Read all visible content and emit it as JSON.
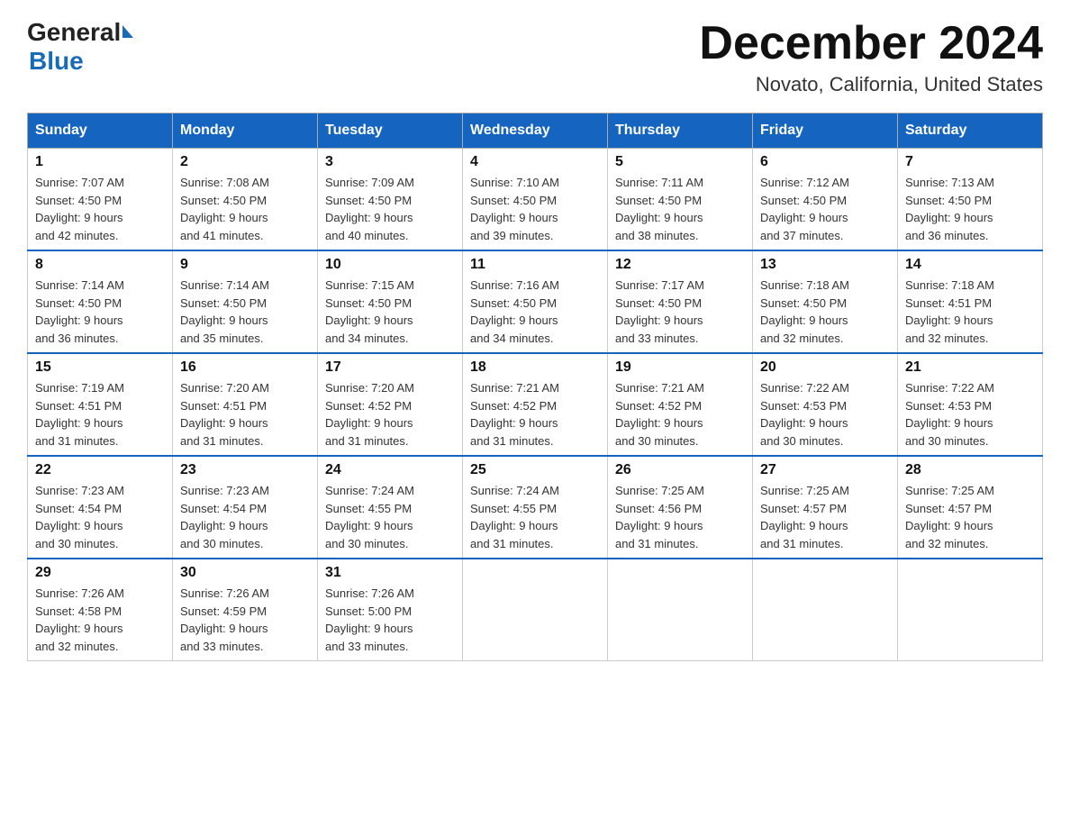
{
  "header": {
    "logo_general": "General",
    "logo_blue": "Blue",
    "month_title": "December 2024",
    "location": "Novato, California, United States"
  },
  "days_of_week": [
    "Sunday",
    "Monday",
    "Tuesday",
    "Wednesday",
    "Thursday",
    "Friday",
    "Saturday"
  ],
  "weeks": [
    [
      {
        "day": "1",
        "sunrise": "7:07 AM",
        "sunset": "4:50 PM",
        "daylight": "9 hours and 42 minutes."
      },
      {
        "day": "2",
        "sunrise": "7:08 AM",
        "sunset": "4:50 PM",
        "daylight": "9 hours and 41 minutes."
      },
      {
        "day": "3",
        "sunrise": "7:09 AM",
        "sunset": "4:50 PM",
        "daylight": "9 hours and 40 minutes."
      },
      {
        "day": "4",
        "sunrise": "7:10 AM",
        "sunset": "4:50 PM",
        "daylight": "9 hours and 39 minutes."
      },
      {
        "day": "5",
        "sunrise": "7:11 AM",
        "sunset": "4:50 PM",
        "daylight": "9 hours and 38 minutes."
      },
      {
        "day": "6",
        "sunrise": "7:12 AM",
        "sunset": "4:50 PM",
        "daylight": "9 hours and 37 minutes."
      },
      {
        "day": "7",
        "sunrise": "7:13 AM",
        "sunset": "4:50 PM",
        "daylight": "9 hours and 36 minutes."
      }
    ],
    [
      {
        "day": "8",
        "sunrise": "7:14 AM",
        "sunset": "4:50 PM",
        "daylight": "9 hours and 36 minutes."
      },
      {
        "day": "9",
        "sunrise": "7:14 AM",
        "sunset": "4:50 PM",
        "daylight": "9 hours and 35 minutes."
      },
      {
        "day": "10",
        "sunrise": "7:15 AM",
        "sunset": "4:50 PM",
        "daylight": "9 hours and 34 minutes."
      },
      {
        "day": "11",
        "sunrise": "7:16 AM",
        "sunset": "4:50 PM",
        "daylight": "9 hours and 34 minutes."
      },
      {
        "day": "12",
        "sunrise": "7:17 AM",
        "sunset": "4:50 PM",
        "daylight": "9 hours and 33 minutes."
      },
      {
        "day": "13",
        "sunrise": "7:18 AM",
        "sunset": "4:50 PM",
        "daylight": "9 hours and 32 minutes."
      },
      {
        "day": "14",
        "sunrise": "7:18 AM",
        "sunset": "4:51 PM",
        "daylight": "9 hours and 32 minutes."
      }
    ],
    [
      {
        "day": "15",
        "sunrise": "7:19 AM",
        "sunset": "4:51 PM",
        "daylight": "9 hours and 31 minutes."
      },
      {
        "day": "16",
        "sunrise": "7:20 AM",
        "sunset": "4:51 PM",
        "daylight": "9 hours and 31 minutes."
      },
      {
        "day": "17",
        "sunrise": "7:20 AM",
        "sunset": "4:52 PM",
        "daylight": "9 hours and 31 minutes."
      },
      {
        "day": "18",
        "sunrise": "7:21 AM",
        "sunset": "4:52 PM",
        "daylight": "9 hours and 31 minutes."
      },
      {
        "day": "19",
        "sunrise": "7:21 AM",
        "sunset": "4:52 PM",
        "daylight": "9 hours and 30 minutes."
      },
      {
        "day": "20",
        "sunrise": "7:22 AM",
        "sunset": "4:53 PM",
        "daylight": "9 hours and 30 minutes."
      },
      {
        "day": "21",
        "sunrise": "7:22 AM",
        "sunset": "4:53 PM",
        "daylight": "9 hours and 30 minutes."
      }
    ],
    [
      {
        "day": "22",
        "sunrise": "7:23 AM",
        "sunset": "4:54 PM",
        "daylight": "9 hours and 30 minutes."
      },
      {
        "day": "23",
        "sunrise": "7:23 AM",
        "sunset": "4:54 PM",
        "daylight": "9 hours and 30 minutes."
      },
      {
        "day": "24",
        "sunrise": "7:24 AM",
        "sunset": "4:55 PM",
        "daylight": "9 hours and 30 minutes."
      },
      {
        "day": "25",
        "sunrise": "7:24 AM",
        "sunset": "4:55 PM",
        "daylight": "9 hours and 31 minutes."
      },
      {
        "day": "26",
        "sunrise": "7:25 AM",
        "sunset": "4:56 PM",
        "daylight": "9 hours and 31 minutes."
      },
      {
        "day": "27",
        "sunrise": "7:25 AM",
        "sunset": "4:57 PM",
        "daylight": "9 hours and 31 minutes."
      },
      {
        "day": "28",
        "sunrise": "7:25 AM",
        "sunset": "4:57 PM",
        "daylight": "9 hours and 32 minutes."
      }
    ],
    [
      {
        "day": "29",
        "sunrise": "7:26 AM",
        "sunset": "4:58 PM",
        "daylight": "9 hours and 32 minutes."
      },
      {
        "day": "30",
        "sunrise": "7:26 AM",
        "sunset": "4:59 PM",
        "daylight": "9 hours and 33 minutes."
      },
      {
        "day": "31",
        "sunrise": "7:26 AM",
        "sunset": "5:00 PM",
        "daylight": "9 hours and 33 minutes."
      },
      null,
      null,
      null,
      null
    ]
  ],
  "labels": {
    "sunrise": "Sunrise:",
    "sunset": "Sunset:",
    "daylight": "Daylight:"
  }
}
